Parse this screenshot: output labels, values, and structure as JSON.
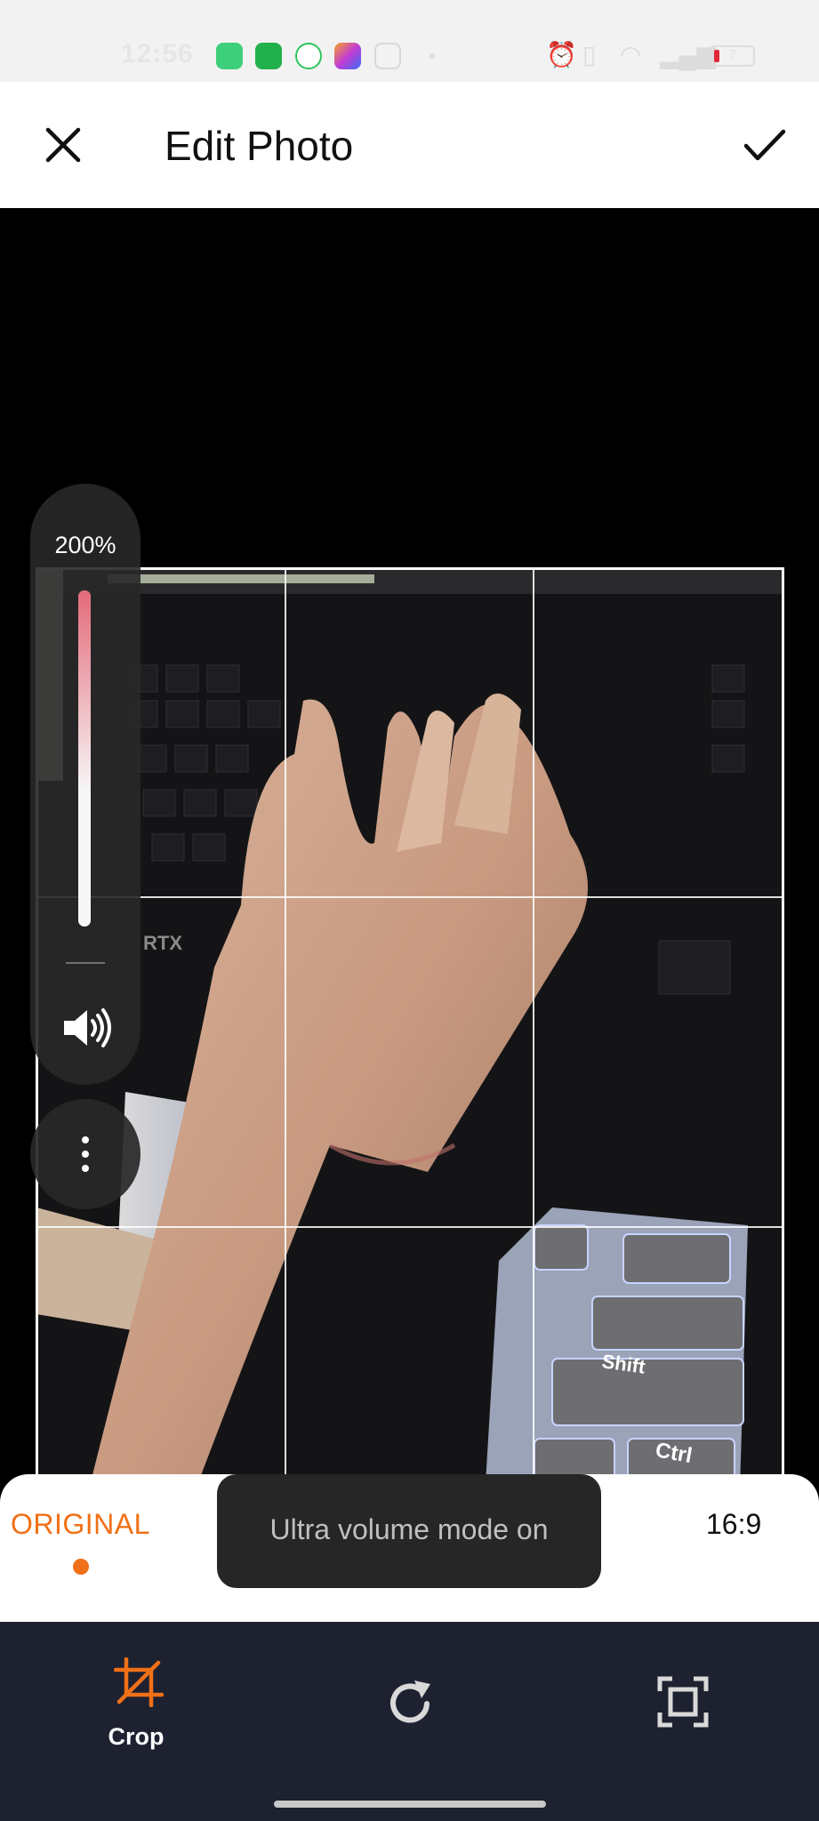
{
  "status_bar": {
    "time": "12:56",
    "app_icons": [
      "battery-saver-icon",
      "vpn-icon",
      "chat-bubble-icon",
      "pen-app-icon",
      "instagram-icon",
      "dot-icon"
    ],
    "right_icons": [
      "alarm-icon",
      "vibrate-icon",
      "wifi-icon",
      "signal-icon"
    ],
    "battery_text": "7"
  },
  "header": {
    "title": "Edit Photo",
    "close_icon": "close-icon",
    "done_icon": "check-icon"
  },
  "volume_panel": {
    "level_label": "200%",
    "level_fraction": 1.0,
    "speaker_icon": "speaker-icon",
    "more_icon": "more-vertical-icon"
  },
  "aspect_ratios": {
    "original_label": "ORIGINAL",
    "ratio_169_label": "16:9",
    "selected": "ORIGINAL"
  },
  "toast": {
    "text": "Ultra volume mode on"
  },
  "toolbar": {
    "crop_label": "Crop",
    "active_color": "#f07017",
    "tools": [
      "crop-icon",
      "rotate-icon",
      "fit-screen-icon"
    ]
  },
  "photo": {
    "key_labels": [
      "Shift",
      "Ctrl",
      "RTX"
    ]
  },
  "colors": {
    "accent": "#f07017",
    "toolbar_bg": "#1e2130",
    "toast_bg": "#262626"
  }
}
